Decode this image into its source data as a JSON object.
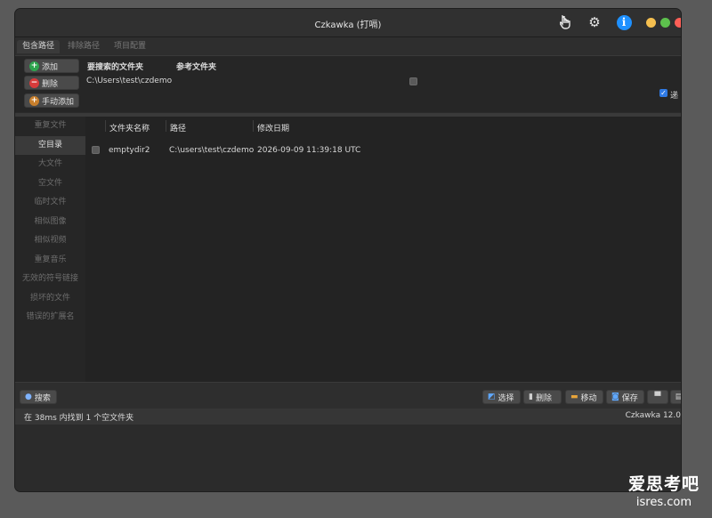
{
  "window": {
    "title": "Czkawka (打嗝)",
    "title_icons": [
      "hand-pointer-icon",
      "gear-icon",
      "info-icon"
    ],
    "traffic_lights": {
      "yellow": "#f5bf4f",
      "green": "#5dc14d",
      "red": "#ff5f57"
    }
  },
  "tabs": [
    {
      "label": "包含路径",
      "active": true
    },
    {
      "label": "排除路径",
      "active": false
    },
    {
      "label": "项目配置",
      "active": false
    }
  ],
  "include_paths": {
    "buttons": {
      "add": "添加",
      "remove": "删除",
      "manual_add": "手动添加"
    },
    "columns": {
      "search_folder": "要搜索的文件夹",
      "reference_folder": "参考文件夹"
    },
    "rows": [
      {
        "path": "C:\\Users\\test\\czdemo",
        "reference": false
      }
    ],
    "recursive_label": "递",
    "recursive_checked": true
  },
  "sidebar": {
    "items": [
      {
        "label": "重复文件",
        "active": false
      },
      {
        "label": "空目录",
        "active": true
      },
      {
        "label": "大文件",
        "active": false
      },
      {
        "label": "空文件",
        "active": false
      },
      {
        "label": "临时文件",
        "active": false
      },
      {
        "label": "相似图像",
        "active": false
      },
      {
        "label": "相似视频",
        "active": false
      },
      {
        "label": "重复音乐",
        "active": false
      },
      {
        "label": "无效的符号链接",
        "active": false
      },
      {
        "label": "损坏的文件",
        "active": false
      },
      {
        "label": "错误的扩展名",
        "active": false
      }
    ]
  },
  "results": {
    "headers": {
      "name": "文件夹名称",
      "path": "路径",
      "modified": "修改日期"
    },
    "rows": [
      {
        "name": "emptydir2",
        "path": "C:\\users\\test\\czdemo",
        "modified": "2026-09-09 11:39:18 UTC",
        "checked": false
      }
    ]
  },
  "bottom": {
    "search": "搜索",
    "select": "选择",
    "delete": "删除",
    "move": "移动",
    "save": "保存"
  },
  "status": {
    "message": "在 38ms 内找到 1 个空文件夹",
    "version": "Czkawka 12.0"
  },
  "watermark": {
    "cn": "爱思考吧",
    "en": "isres.com"
  }
}
